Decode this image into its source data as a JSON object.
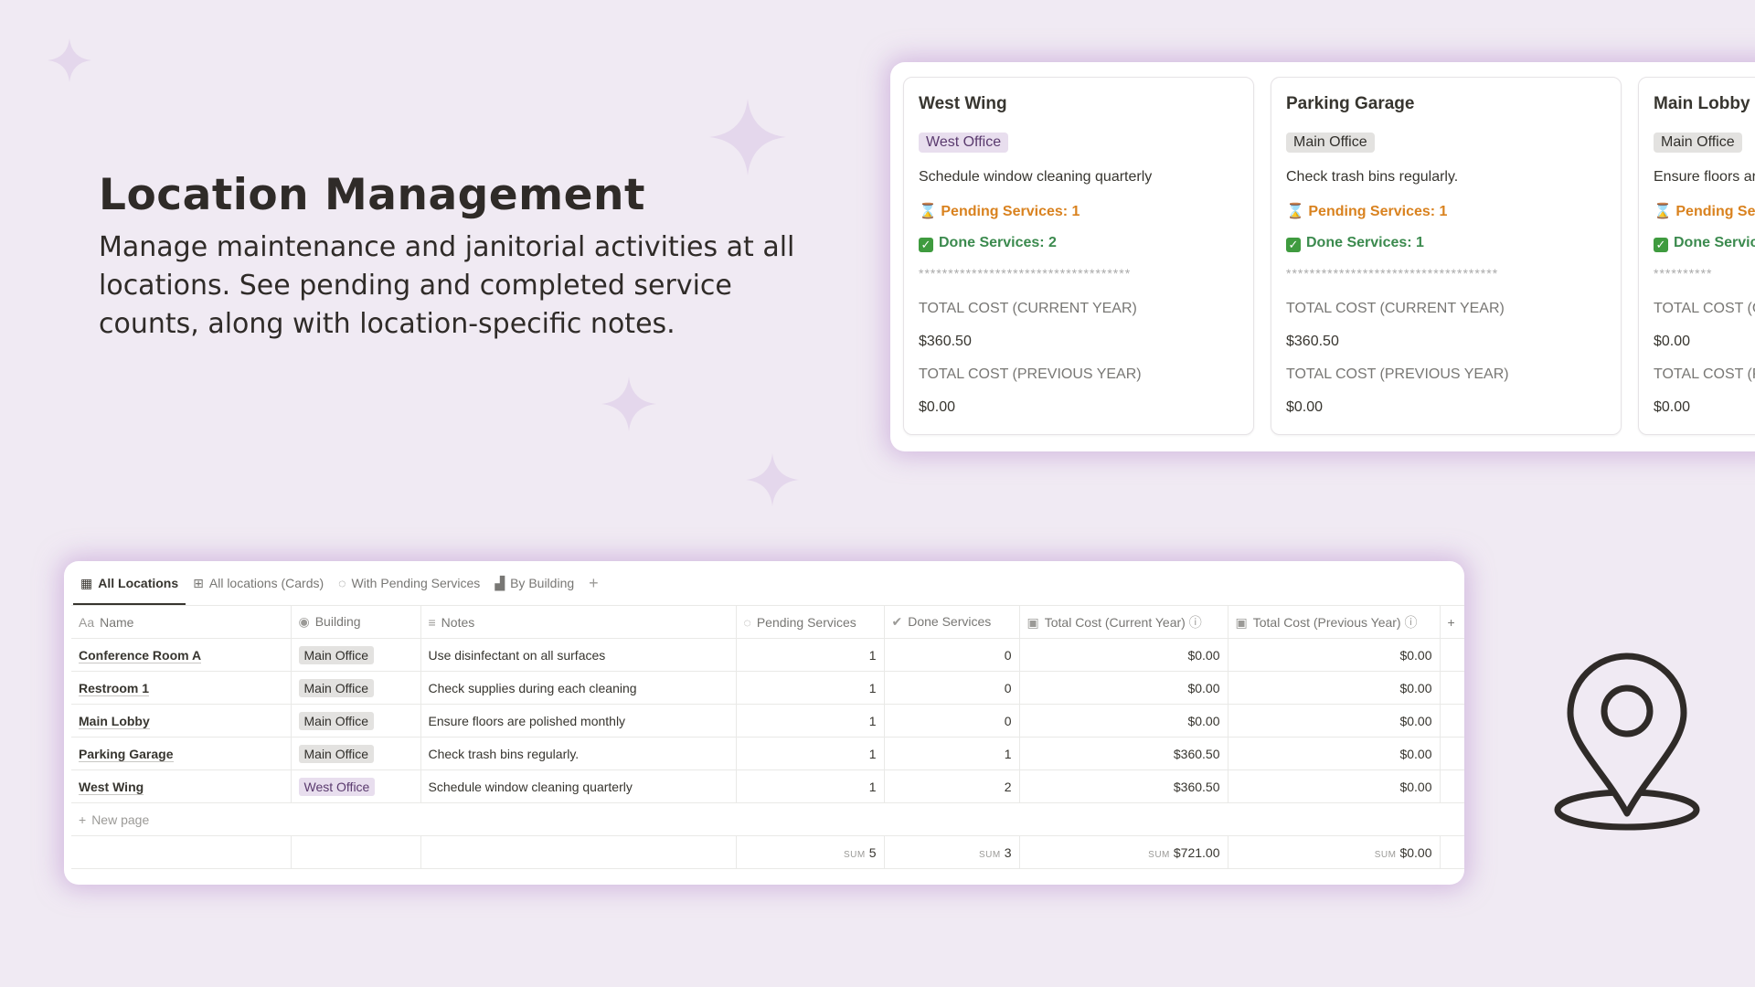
{
  "hero": {
    "title": "Location Management",
    "description": "Manage maintenance and janitorial activities at all locations.  See pending and completed service counts, along with location-specific notes."
  },
  "cards": [
    {
      "title": "West Wing",
      "tag": "West Office",
      "tag_color": "purple",
      "note": "Schedule window cleaning quarterly",
      "pending": "Pending Services: 1",
      "done": "Done Services: 2",
      "separator": "************************************",
      "label_current": "TOTAL COST (CURRENT YEAR)",
      "value_current": "$360.50",
      "label_previous": "TOTAL COST (PREVIOUS YEAR)",
      "value_previous": "$0.00"
    },
    {
      "title": "Parking Garage",
      "tag": "Main Office",
      "tag_color": "gray",
      "note": "Check trash bins regularly.",
      "pending": "Pending Services: 1",
      "done": "Done Services: 1",
      "separator": "************************************",
      "label_current": "TOTAL COST (CURRENT YEAR)",
      "value_current": "$360.50",
      "label_previous": "TOTAL COST (PREVIOUS YEAR)",
      "value_previous": "$0.00"
    },
    {
      "title": "Main Lobby",
      "tag": "Main Office",
      "tag_color": "gray",
      "note": "Ensure floors ar",
      "pending": "Pending Se",
      "done": "Done Servic",
      "separator": "**********",
      "label_current": "TOTAL COST (C",
      "value_current": "$0.00",
      "label_previous": "TOTAL COST (P",
      "value_previous": "$0.00"
    }
  ],
  "tabs": [
    {
      "label": "All Locations",
      "icon": "table-icon"
    },
    {
      "label": "All locations (Cards)",
      "icon": "gallery-icon"
    },
    {
      "label": "With Pending Services",
      "icon": "dashed-circle-icon"
    },
    {
      "label": "By Building",
      "icon": "bar-chart-icon"
    }
  ],
  "tab_add": "+",
  "columns": {
    "name_prefix": "Aa",
    "name": "Name",
    "building": "Building",
    "notes": "Notes",
    "pending": "Pending Services",
    "done": "Done Services",
    "cost_current": "Total Cost (Current Year)",
    "cost_previous": "Total Cost (Previous Year)",
    "add": "+"
  },
  "rows": [
    {
      "name": "Conference Room A",
      "building": "Main Office",
      "notes": "Use disinfectant on all surfaces",
      "pending": "1",
      "done": "0",
      "cost_current": "$0.00",
      "cost_previous": "$0.00"
    },
    {
      "name": "Restroom 1",
      "building": "Main Office",
      "notes": "Check supplies during each cleaning",
      "pending": "1",
      "done": "0",
      "cost_current": "$0.00",
      "cost_previous": "$0.00"
    },
    {
      "name": "Main Lobby",
      "building": "Main Office",
      "notes": "Ensure floors are polished monthly",
      "pending": "1",
      "done": "0",
      "cost_current": "$0.00",
      "cost_previous": "$0.00"
    },
    {
      "name": "Parking Garage",
      "building": "Main Office",
      "notes": "Check trash bins regularly.",
      "pending": "1",
      "done": "1",
      "cost_current": "$360.50",
      "cost_previous": "$0.00"
    },
    {
      "name": "West Wing",
      "building": "West Office",
      "notes": "Schedule window cleaning quarterly",
      "pending": "1",
      "done": "2",
      "cost_current": "$360.50",
      "cost_previous": "$0.00"
    }
  ],
  "new_page": "New page",
  "sums": {
    "label": "SUM",
    "pending": "5",
    "done": "3",
    "cost_current": "$721.00",
    "cost_previous": "$0.00"
  },
  "colors": {
    "background": "#f0eaf3",
    "sparkle": "#e4d7ec",
    "pending": "#d9821f",
    "done": "#3b8a4e",
    "tag_purple": "#e8deee",
    "tag_gray": "#e3e2e0",
    "pin_stroke": "#2f2b28"
  }
}
